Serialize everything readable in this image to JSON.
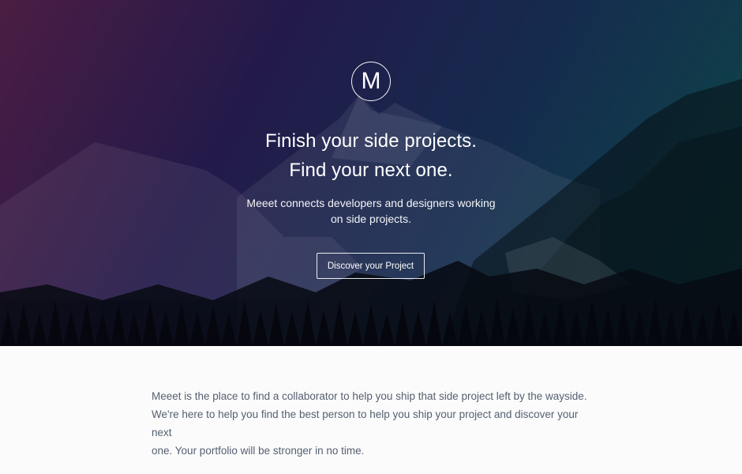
{
  "hero": {
    "logo_letter": "M",
    "headline_line1": "Finish your side projects.",
    "headline_line2": "Find your next one.",
    "subtitle_line1": "Meeet connects developers and designers working",
    "subtitle_line2": "on side projects.",
    "cta_label": "Discover your Project",
    "background_image": "mountain-forest-landscape",
    "overlay_colors": [
      "#4b1d43",
      "#231a4a",
      "#152b4e",
      "#0c4a46"
    ]
  },
  "about": {
    "line1": "Meeet is the place to find a collaborator to help you ship that side project left by the wayside.",
    "line2": "We're here to help you find the best person to help you ship your project and discover your next",
    "line3": "one. Your portfolio will be stronger in no time."
  }
}
